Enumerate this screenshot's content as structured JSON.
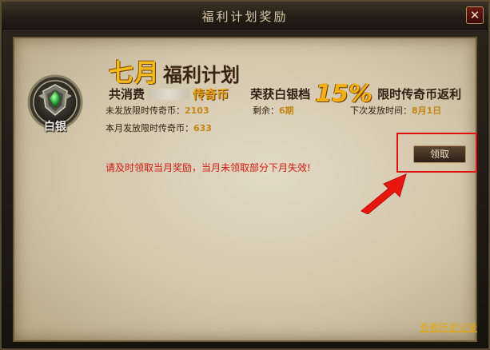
{
  "window": {
    "title": "福利计划奖励",
    "close_symbol": "✕"
  },
  "badge": {
    "label": "白银",
    "icon": "silver-shield-emblem"
  },
  "heading": {
    "month": "七月",
    "title": "福利计划"
  },
  "summary": {
    "spent_prefix": "共消费",
    "currency": "传奇币",
    "tier_text": "荣获白银档",
    "rebate_percent": "15%",
    "rebate_text": "限时传奇币返利"
  },
  "info": {
    "unissued_label": "未发放限时传奇币：",
    "unissued_value": "2103",
    "remaining_label": "剩余：",
    "remaining_value": "6期",
    "next_label": "下次发放时间：",
    "next_value": "8月1日",
    "month_issued_label": "本月发放限时传奇币：",
    "month_issued_value": "633"
  },
  "notice": "请及时领取当月奖励，当月未领取部分下月失效!",
  "buttons": {
    "claim": "领取"
  },
  "footer": {
    "history_link": "查看历史记录"
  },
  "colors": {
    "accent_gold": "#f2bb1c",
    "notice_red": "#d21a10",
    "highlight_red": "#e0120f",
    "link_yellow": "#e0a80f"
  }
}
